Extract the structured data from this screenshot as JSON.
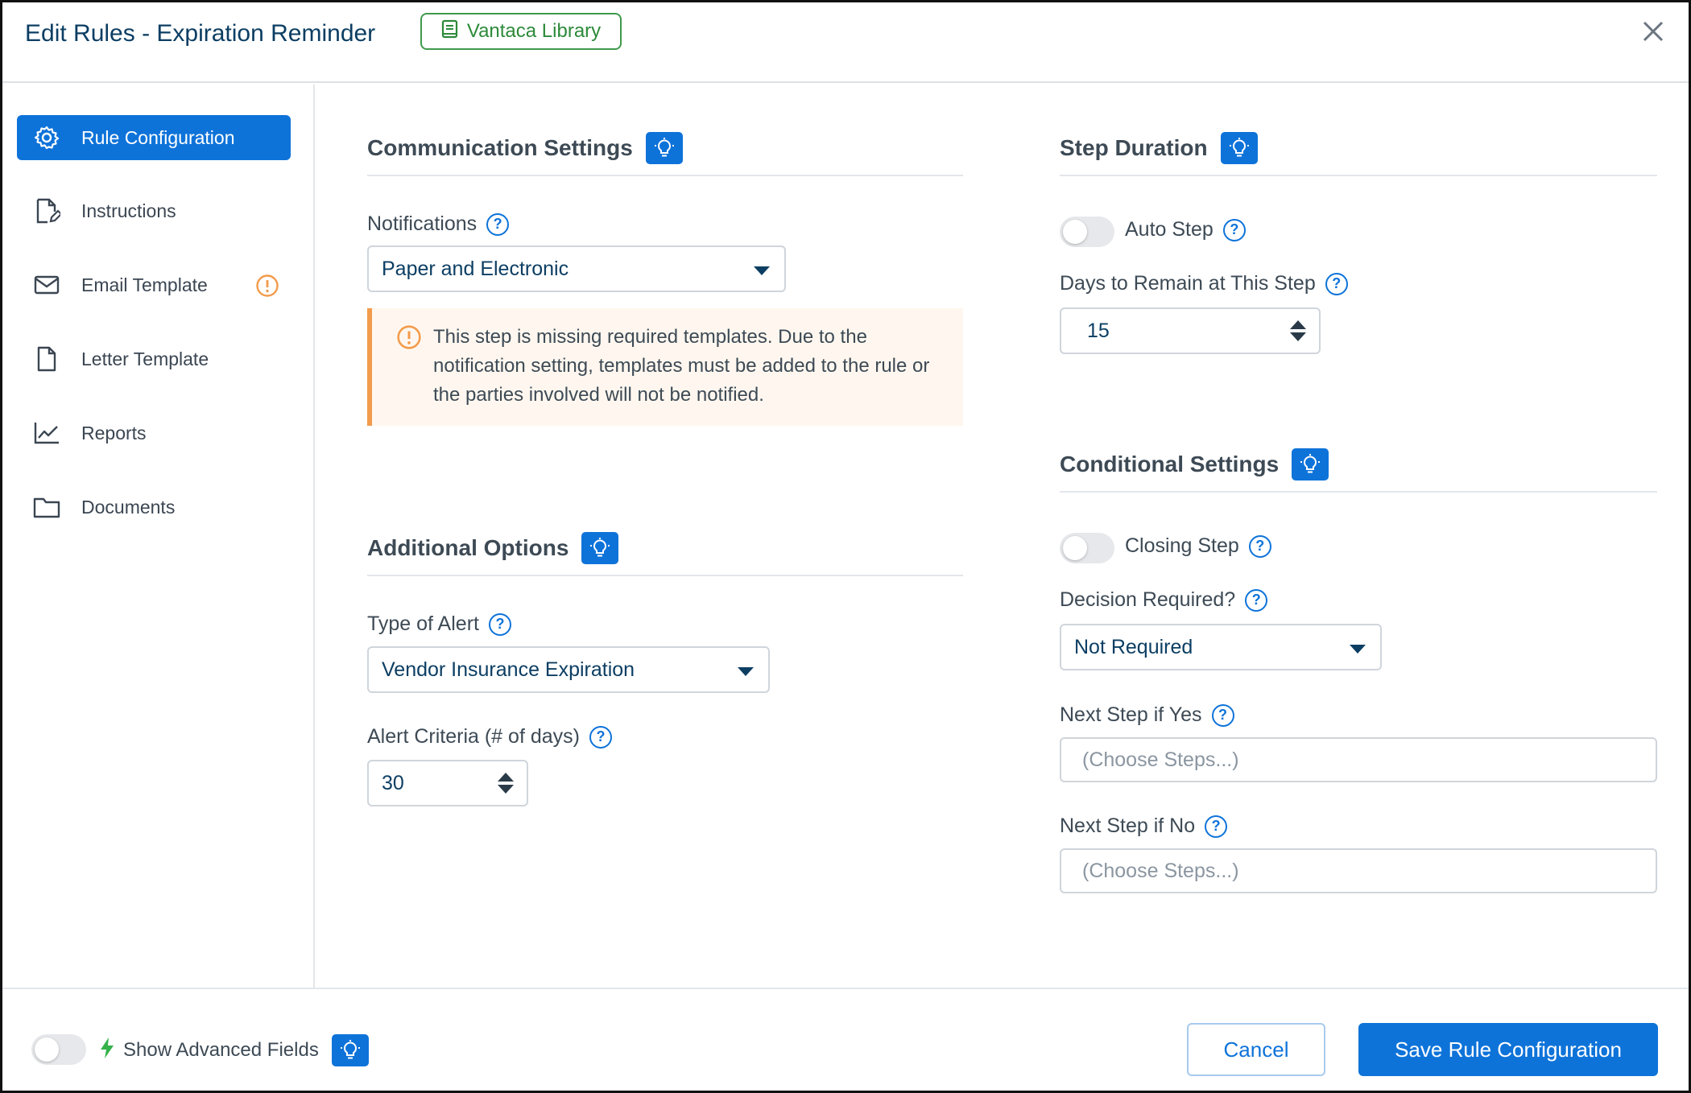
{
  "header": {
    "title": "Edit Rules - Expiration Reminder",
    "library_badge": "Vantaca Library"
  },
  "sidebar": {
    "items": [
      {
        "label": "Rule Configuration",
        "icon": "gear-icon",
        "active": true
      },
      {
        "label": "Instructions",
        "icon": "document-edit-icon"
      },
      {
        "label": "Email Template",
        "icon": "envelope-icon",
        "warning": true
      },
      {
        "label": "Letter Template",
        "icon": "document-icon"
      },
      {
        "label": "Reports",
        "icon": "line-chart-icon"
      },
      {
        "label": "Documents",
        "icon": "folder-icon"
      }
    ]
  },
  "communication": {
    "title": "Communication Settings",
    "notifications_label": "Notifications",
    "notifications_value": "Paper and Electronic",
    "alert_text": "This step is missing required templates. Due to the notification setting, templates must be added to the rule or the parties involved will not be notified."
  },
  "additional": {
    "title": "Additional Options",
    "alert_type_label": "Type of Alert",
    "alert_type_value": "Vendor Insurance Expiration",
    "criteria_label": "Alert Criteria (# of days)",
    "criteria_value": "30"
  },
  "duration": {
    "title": "Step Duration",
    "auto_step_label": "Auto Step",
    "days_label": "Days to Remain at This Step",
    "days_value": "15"
  },
  "conditional": {
    "title": "Conditional Settings",
    "closing_step_label": "Closing Step",
    "decision_label": "Decision Required?",
    "decision_value": "Not Required",
    "next_yes_label": "Next Step if Yes",
    "next_yes_placeholder": "(Choose Steps...)",
    "next_no_label": "Next Step if No",
    "next_no_placeholder": "(Choose Steps...)"
  },
  "footer": {
    "advanced_label": "Show Advanced Fields",
    "cancel_label": "Cancel",
    "save_label": "Save Rule Configuration"
  },
  "colors": {
    "primary": "#0e73d9",
    "title": "#0c3e63",
    "library_green": "#2d8a3a",
    "warning_orange": "#f29b4b",
    "alert_bg": "#fff7ef"
  }
}
